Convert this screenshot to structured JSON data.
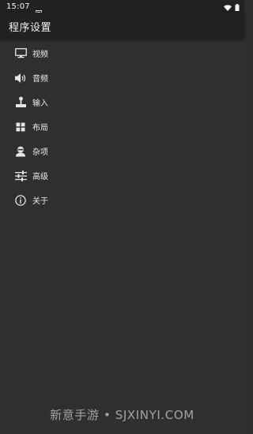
{
  "status_bar": {
    "time": "15:07",
    "notification_icon": "notification-icon",
    "wifi_icon": "wifi-icon",
    "battery_icon": "battery-icon"
  },
  "app_bar": {
    "title": "程序设置"
  },
  "menu": {
    "items": [
      {
        "label": "视频",
        "icon": "monitor-icon"
      },
      {
        "label": "音频",
        "icon": "speaker-icon"
      },
      {
        "label": "输入",
        "icon": "joystick-icon"
      },
      {
        "label": "布局",
        "icon": "grid-icon"
      },
      {
        "label": "杂项",
        "icon": "person-icon"
      },
      {
        "label": "高级",
        "icon": "sliders-icon"
      },
      {
        "label": "关于",
        "icon": "info-icon"
      }
    ]
  },
  "watermark": {
    "text": "新意手游 • SJXINYI.COM"
  },
  "colors": {
    "background": "#2f2f2f",
    "app_bar": "#212121",
    "status_bar": "#222222",
    "text": "#eaeaea"
  }
}
